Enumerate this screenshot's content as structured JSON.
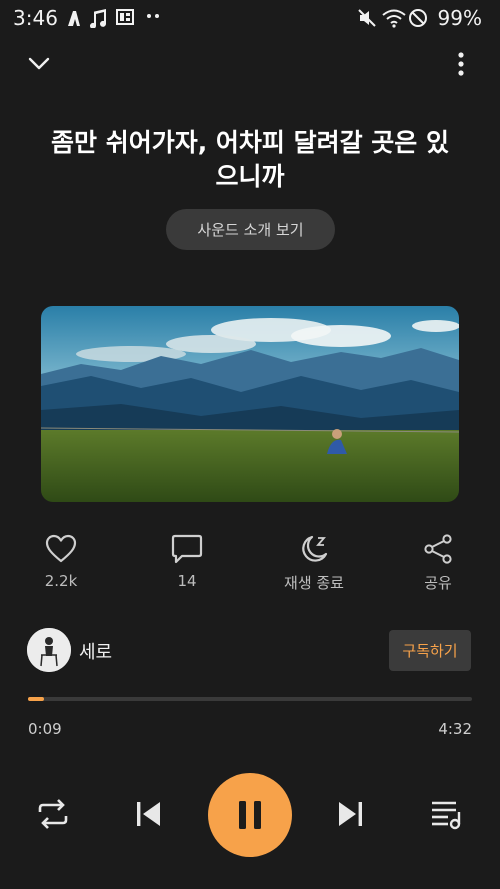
{
  "status_bar": {
    "time": "3:46",
    "battery": "99%",
    "icons": [
      "artist-app-icon",
      "music-note-icon",
      "gallery-icon",
      "more-dots-icon",
      "mute-icon",
      "wifi-icon",
      "do-not-disturb-icon"
    ]
  },
  "header": {
    "collapse_icon": "chevron-down-icon",
    "menu_icon": "more-vertical-icon"
  },
  "track": {
    "title": "좀만 쉬어가자, 어차피 달려갈 곳은 있으니까",
    "sound_intro_label": "사운드 소개 보기"
  },
  "actions": {
    "like_count": "2.2k",
    "comment_count": "14",
    "sleep_label": "재생 종료",
    "share_label": "공유"
  },
  "artist": {
    "name": "세로",
    "subscribe_label": "구독하기"
  },
  "progress": {
    "current": "0:09",
    "total": "4:32",
    "fraction": 0.035
  },
  "controls": {
    "repeat_icon": "repeat-icon",
    "prev_icon": "skip-previous-icon",
    "play_icon": "pause-icon",
    "next_icon": "skip-next-icon",
    "playlist_icon": "playlist-icon"
  },
  "colors": {
    "accent": "#f7a24a",
    "background": "#1b1b1b"
  }
}
